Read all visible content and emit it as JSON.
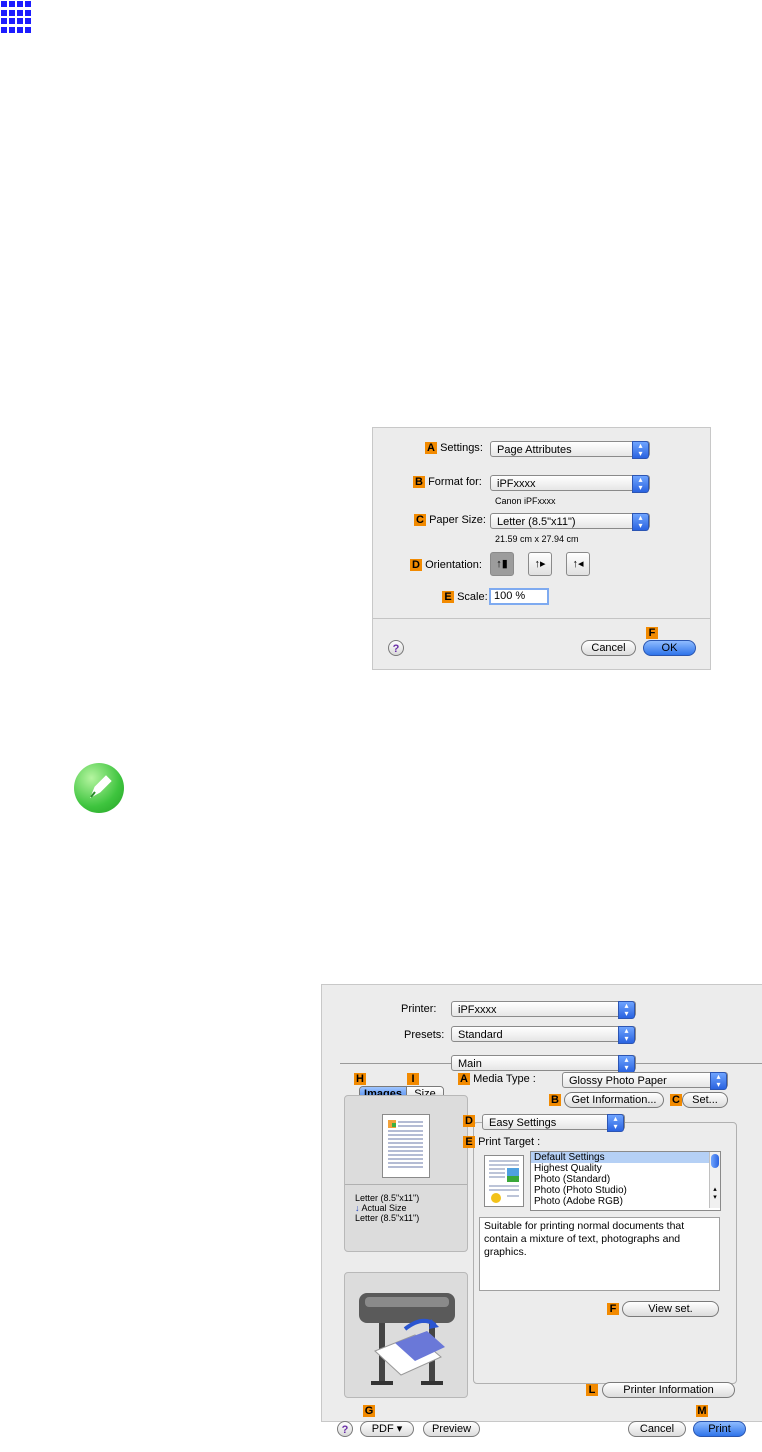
{
  "page_setup_dialog": {
    "settings_label": "Settings",
    "settings_value": "Page Attributes",
    "format_for_label": "Format for:",
    "format_for_value": "iPFxxxx",
    "format_for_sub": "Canon iPFxxxx",
    "paper_size_label": "Paper Size",
    "paper_size_value": "Letter (8.5\"x11\")",
    "paper_size_sub": "21.59 cm x 27.94 cm",
    "orientation_label": "Orientation:",
    "scale_label": "Scale:",
    "scale_value": "100 %",
    "cancel_label": "Cancel",
    "ok_label": "OK",
    "help_label": "?",
    "badges": {
      "a": "A",
      "b": "B",
      "c": "C",
      "d": "D",
      "e": "E",
      "f": "F"
    }
  },
  "print_dialog": {
    "printer_label": "Printer:",
    "printer_value": "iPFxxxx",
    "presets_label": "Presets:",
    "presets_value": "Standard",
    "panel_value": "Main",
    "tabs": {
      "images": "Images",
      "size": "Size"
    },
    "media_type_label": "Media Type :",
    "media_type_value": "Glossy Photo Paper",
    "get_information_label": "Get Information...",
    "set_label": "Set...",
    "easy_settings_value": "Easy Settings",
    "print_target_label": "Print Target :",
    "print_targets": [
      "Default Settings",
      "Highest Quality",
      "Photo (Standard)",
      "Photo (Photo Studio)",
      "Photo (Adobe RGB)"
    ],
    "description": "Suitable for printing normal documents that contain a mixture of text, photographs and graphics.",
    "view_set_label": "View set.",
    "printer_information_label": "Printer Information",
    "preview_size_1": "Letter (8.5\"x11\")",
    "actual_size": "Actual Size",
    "preview_size_2": "Letter (8.5\"x11\")",
    "pdf_label": "PDF ▾",
    "preview_label": "Preview",
    "cancel_label": "Cancel",
    "print_label": "Print",
    "help_label": "?",
    "badges": {
      "a": "A",
      "b": "B",
      "c": "C",
      "d": "D",
      "e": "E",
      "f": "F",
      "g": "G",
      "h": "H",
      "i": "I",
      "l": "L",
      "m": "M"
    }
  },
  "colors": {
    "badge": "#f28a00",
    "accent": "#2f74ea",
    "note_icon": "#3ec43e",
    "grid_icon": "#1c1cff"
  },
  "icons": [
    "grid-icon",
    "note-pencil-icon",
    "printer-illustration",
    "paper-preview-icon"
  ]
}
